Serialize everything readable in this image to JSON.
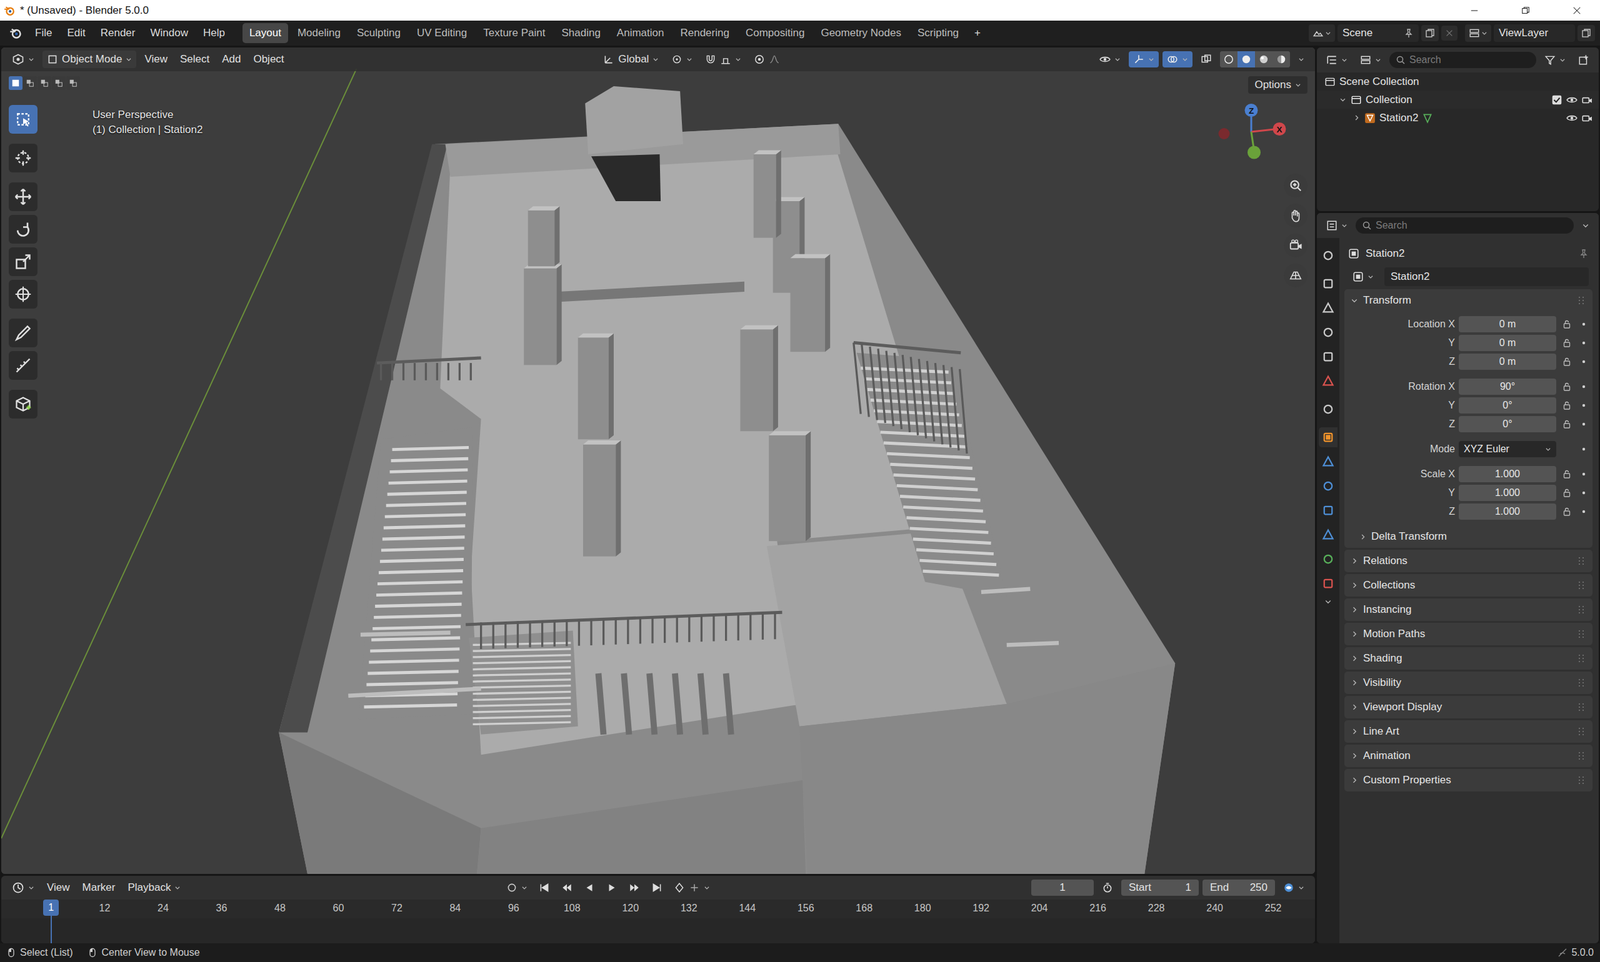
{
  "window": {
    "title": "* (Unsaved) - Blender 5.0.0"
  },
  "menu": [
    "File",
    "Edit",
    "Render",
    "Window",
    "Help"
  ],
  "workspaces": [
    {
      "label": "Layout",
      "selected": true
    },
    {
      "label": "Modeling",
      "selected": false
    },
    {
      "label": "Sculpting",
      "selected": false
    },
    {
      "label": "UV Editing",
      "selected": false
    },
    {
      "label": "Texture Paint",
      "selected": false
    },
    {
      "label": "Shading",
      "selected": false
    },
    {
      "label": "Animation",
      "selected": false
    },
    {
      "label": "Rendering",
      "selected": false
    },
    {
      "label": "Compositing",
      "selected": false
    },
    {
      "label": "Geometry Nodes",
      "selected": false
    },
    {
      "label": "Scripting",
      "selected": false
    }
  ],
  "add_workspace": "+",
  "scene": "Scene",
  "view_layer": "ViewLayer",
  "viewport": {
    "select_modes": [
      {
        "selected": true
      },
      {
        "selected": false
      },
      {
        "selected": false
      },
      {
        "selected": false
      },
      {
        "selected": false
      }
    ],
    "mode": "Object Mode",
    "menus": [
      "View",
      "Select",
      "Add",
      "Object"
    ],
    "orientation": "Global",
    "toggles": [
      {
        "selected": true
      },
      {
        "selected": true
      },
      {
        "selected": false
      }
    ],
    "shading": [
      {
        "selected": false
      },
      {
        "selected": true
      },
      {
        "selected": false
      },
      {
        "selected": false
      }
    ],
    "options": "Options",
    "perspective": "User Perspective",
    "context": "(1) Collection | Station2",
    "tools": [
      {
        "selected": true
      },
      {
        "selected": false
      },
      {
        "selected": false
      },
      {
        "selected": false
      },
      {
        "selected": false
      },
      {
        "selected": false
      },
      {
        "selected": false
      },
      {
        "selected": false
      },
      {
        "selected": false
      }
    ],
    "gizmo": {
      "z": "Z",
      "x": "X"
    }
  },
  "outliner": {
    "search_placeholder": "Search",
    "items": [
      {
        "label": "Scene Collection",
        "depth": 0,
        "kind": "scene"
      },
      {
        "label": "Collection",
        "depth": 1,
        "kind": "collection",
        "expanded": true,
        "checked": true,
        "visible": true,
        "renderable": true
      },
      {
        "label": "Station2",
        "depth": 2,
        "kind": "object",
        "expanded": false,
        "visible": true,
        "renderable": true
      }
    ]
  },
  "properties": {
    "search_placeholder": "Search",
    "tabs": [
      {
        "selected": false
      },
      {
        "selected": false
      },
      {
        "selected": false
      },
      {
        "selected": false
      },
      {
        "selected": false
      },
      {
        "selected": false
      },
      {
        "selected": false
      },
      {
        "selected": true
      },
      {
        "selected": false
      },
      {
        "selected": false
      },
      {
        "selected": false
      },
      {
        "selected": false
      },
      {
        "selected": false
      },
      {
        "selected": false
      }
    ],
    "object": "Station2",
    "datablock": "Station2",
    "transform": {
      "title": "Transform",
      "expanded": true,
      "groups": [
        [
          {
            "kind": "field",
            "label": "Location X",
            "value": "0 m"
          },
          {
            "kind": "field",
            "label": "Y",
            "value": "0 m"
          },
          {
            "kind": "field",
            "label": "Z",
            "value": "0 m"
          }
        ],
        [
          {
            "kind": "field",
            "label": "Rotation X",
            "value": "90°"
          },
          {
            "kind": "field",
            "label": "Y",
            "value": "0°"
          },
          {
            "kind": "field",
            "label": "Z",
            "value": "0°"
          }
        ],
        [
          {
            "kind": "select",
            "label": "Mode",
            "value": "XYZ Euler"
          }
        ],
        [
          {
            "kind": "field",
            "label": "Scale X",
            "value": "1.000"
          },
          {
            "kind": "field",
            "label": "Y",
            "value": "1.000"
          },
          {
            "kind": "field",
            "label": "Z",
            "value": "1.000"
          }
        ]
      ],
      "subpanel": {
        "title": "Delta Transform",
        "expanded": false
      }
    },
    "panels": [
      {
        "title": "Relations",
        "expanded": false
      },
      {
        "title": "Collections",
        "expanded": false
      },
      {
        "title": "Instancing",
        "expanded": false
      },
      {
        "title": "Motion Paths",
        "expanded": false
      },
      {
        "title": "Shading",
        "expanded": false
      },
      {
        "title": "Visibility",
        "expanded": false
      },
      {
        "title": "Viewport Display",
        "expanded": false
      },
      {
        "title": "Line Art",
        "expanded": false
      },
      {
        "title": "Animation",
        "expanded": false
      },
      {
        "title": "Custom Properties",
        "expanded": false
      }
    ]
  },
  "timeline": {
    "menus": [
      "View",
      "Marker",
      "Playback"
    ],
    "frame": "1",
    "start_label": "Start",
    "start": "1",
    "end_label": "End",
    "end": "250",
    "current_frame": "1",
    "ticks": [
      "12",
      "24",
      "36",
      "48",
      "60",
      "72",
      "84",
      "96",
      "108",
      "120",
      "132",
      "144",
      "156",
      "168",
      "180",
      "192",
      "204",
      "216",
      "228",
      "240",
      "252"
    ]
  },
  "status_bar": {
    "hints": [
      "Select (List)",
      "Center View to Mouse"
    ],
    "version": "5.0.0"
  }
}
